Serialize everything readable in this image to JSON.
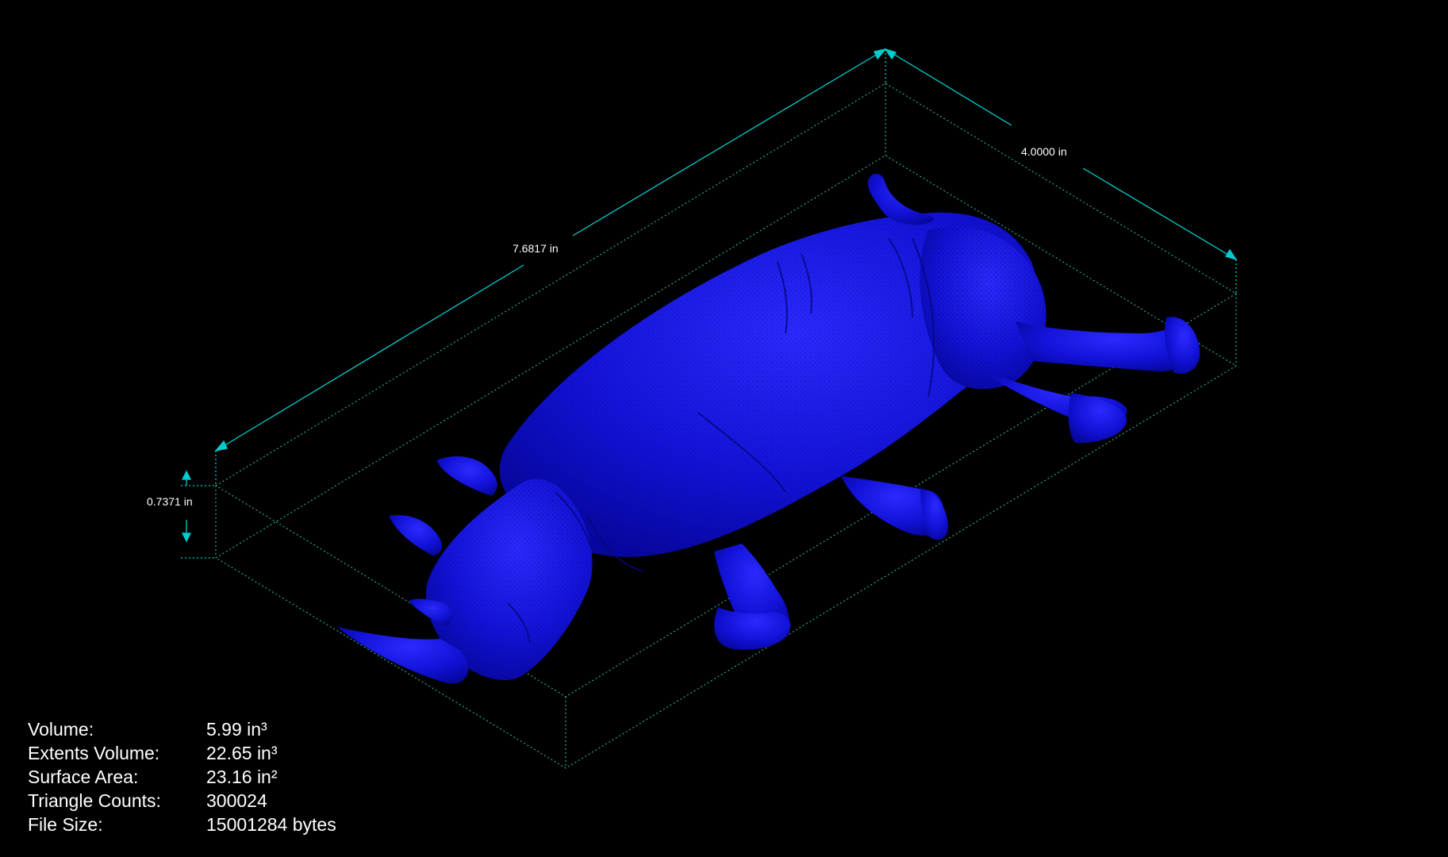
{
  "viewport": {
    "model_name": "rhinoceros",
    "model_color": "#1111dd",
    "dimension_color": "#00cccc",
    "bounding_box_color": "#2aa89a",
    "background_color": "#000000"
  },
  "dimensions": {
    "length": "7.6817 in",
    "width": "4.0000 in",
    "height": "0.7371 in"
  },
  "stats": [
    {
      "label": "Volume:",
      "value": "5.99 in³"
    },
    {
      "label": "Extents Volume:",
      "value": "22.65 in³"
    },
    {
      "label": "Surface Area:",
      "value": "23.16 in²"
    },
    {
      "label": "Triangle Counts:",
      "value": "300024"
    },
    {
      "label": "File Size:",
      "value": "15001284 bytes"
    }
  ]
}
